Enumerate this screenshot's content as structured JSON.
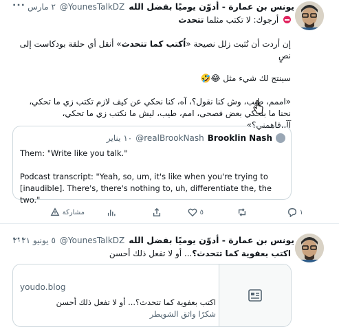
{
  "tweet1": {
    "author_name": "يونس بن عمارة - أدوّن يوميًا بفضل الله",
    "handle": "@YounesTalkDZ",
    "date": "٢ مارس",
    "more": "···",
    "subtitle_prefix": "أرجوك: لا تكتب مثلما",
    "subtitle_emph": "تتحدث",
    "para1_a": "إن أردت أن تُثبت زلل نصيحة «",
    "para1_emph": "اُكتب كما تتحدث",
    "para1_b": "» أنقل أي حلقة بودكاست إلى نصٍ",
    "para2": "سينتج لك شيء مثل 😂🤣",
    "para3": "«اممم، طيب، وش كنا نقول؟، آه، كنا نحكي عن كيف لازم تكتب زي ما تحكي، نحنا ما بنحكي بعض فصحى، امم، طيب، ليش ما نكتب زي ما تحكي، آآ..فاهمني؟»",
    "quote": {
      "name": "Brooklin Nash",
      "handle": "@realBrookNash",
      "date": "١٠ يناير",
      "line1": "Them: \"Write like you talk.\"",
      "line2": "Podcast transcript: \"Yeah, so, um, it's like when you're trying to [inaudible]. There's, there's nothing to, uh, differentiate the, the two.\""
    },
    "actions": {
      "reply_count": "١",
      "retweet_count": "",
      "like_count": "٥",
      "share_label": "مشاركة"
    }
  },
  "tweet2": {
    "author_name": "يونس بن عمارة - أدوّن يوميًا بفضل الله",
    "handle": "@YounesTalkDZ",
    "date": "٥ يونيو ٢٠٢١",
    "more": "···",
    "text_prefix": "اكتب بعفوية",
    "text_emph": "كما تتحدث؟",
    "text_suffix": "... أو لا تفعل ذلك أحسن",
    "card": {
      "domain": "youdo.blog",
      "title": "اكتب بعفوية كما تتحدث؟... أو لا تفعل ذلك أحسن",
      "subtitle": "شكرًا واثق الشويطر"
    }
  },
  "colors": {
    "text": "#0f1419",
    "muted": "#536471",
    "border": "#cfd9de",
    "no_entry": "#e0245e"
  }
}
